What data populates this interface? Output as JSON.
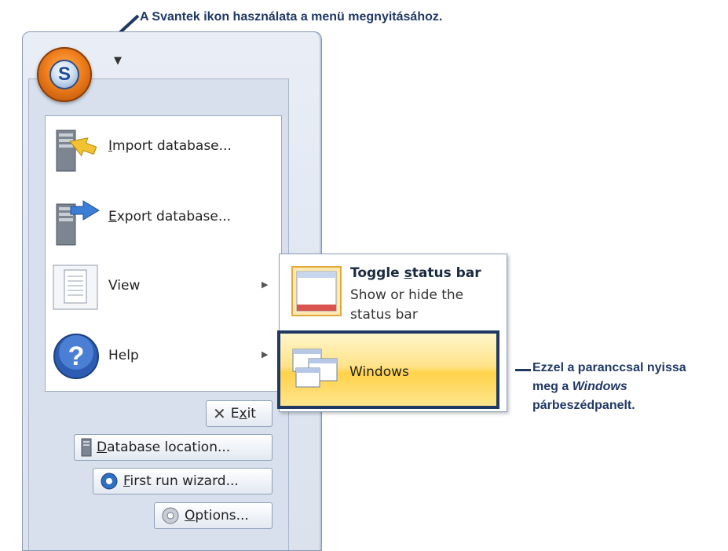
{
  "callouts": {
    "top": "A Svantek ikon használata a menü megnyitásához.",
    "right_line1": "Ezzel a paranccsal nyissa",
    "right_line2_pre": "meg a ",
    "right_line2_em": "Windows",
    "right_line3": "párbeszédpanelt."
  },
  "menu": {
    "items": [
      {
        "label_pre": "",
        "label_ul": "I",
        "label_post": "mport database...",
        "icon": "import-database-icon"
      },
      {
        "label_pre": "",
        "label_ul": "E",
        "label_post": "xport database...",
        "icon": "export-database-icon"
      },
      {
        "label_pre": "",
        "label_ul": "",
        "label_post": "View",
        "icon": "view-icon",
        "has_submenu": true
      },
      {
        "label_pre": "",
        "label_ul": "",
        "label_post": "Help",
        "icon": "help-icon",
        "has_submenu": true
      }
    ]
  },
  "buttons": {
    "exit": {
      "pre": "E",
      "ul": "x",
      "post": "it"
    },
    "database_location": {
      "pre": "",
      "ul": "D",
      "post": "atabase location..."
    },
    "first_run": {
      "pre": "",
      "ul": "F",
      "post": "irst run wizard..."
    },
    "options": {
      "pre": "",
      "ul": "O",
      "post": "ptions..."
    }
  },
  "submenu": {
    "toggle_title_pre": "Toggle ",
    "toggle_title_ul": "s",
    "toggle_title_post": "tatus bar",
    "toggle_desc": "Show or hide the status bar",
    "windows_label": "Windows"
  },
  "colors": {
    "callout": "#1f3864",
    "orb": "#f07f1b",
    "highlight": "#ffd24a"
  }
}
